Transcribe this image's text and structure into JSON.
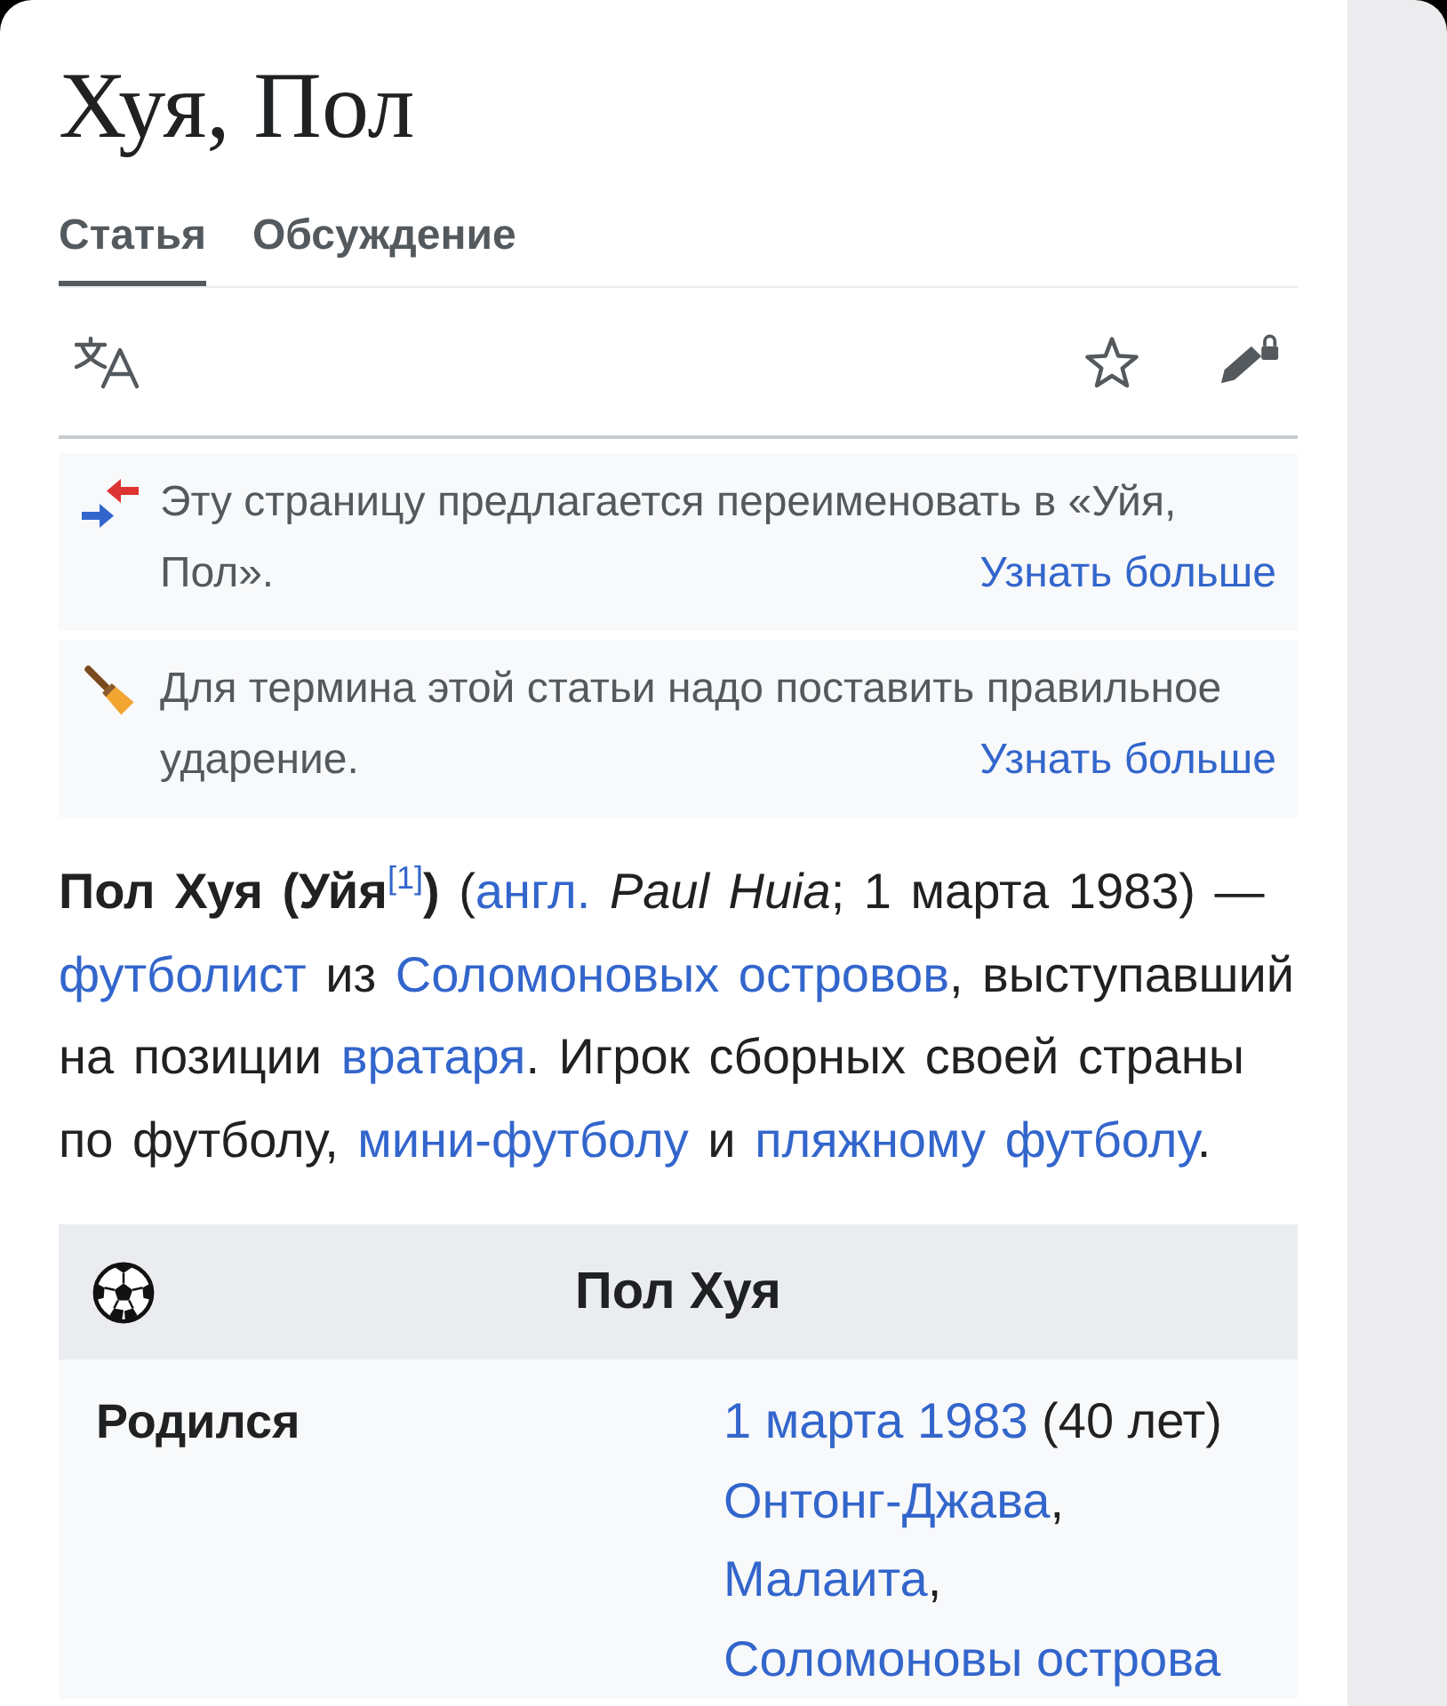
{
  "page": {
    "title": "Хуя, Пол"
  },
  "tabs": [
    {
      "label": "Статья",
      "selected": true
    },
    {
      "label": "Обсуждение",
      "selected": false
    }
  ],
  "notices": [
    {
      "kind": "rename",
      "text": "Эту страницу предлагается переименовать в «Уйя, Пол».",
      "link": "Узнать больше"
    },
    {
      "kind": "stress",
      "text": "Для термина этой статьи надо поставить правильное ударение.",
      "link": "Узнать больше"
    }
  ],
  "lead": [
    {
      "kind": "bold",
      "text": "Пол Хуя (Уйя"
    },
    {
      "kind": "ref",
      "text": "[1]"
    },
    {
      "kind": "bold",
      "text": ")"
    },
    {
      "kind": "text",
      "text": " ("
    },
    {
      "kind": "link",
      "text": "англ."
    },
    {
      "kind": "text",
      "text": " *Paul Huia*; 1 марта 1983) — "
    },
    {
      "kind": "link",
      "text": "футболист"
    },
    {
      "kind": "text",
      "text": " из "
    },
    {
      "kind": "link",
      "text": "Соломоновых островов"
    },
    {
      "kind": "text",
      "text": ", выступавший на позиции "
    },
    {
      "kind": "link",
      "text": "вратаря"
    },
    {
      "kind": "text",
      "text": ". Игрок сборных своей страны по футболу, "
    },
    {
      "kind": "link",
      "text": "мини-футболу"
    },
    {
      "kind": "text",
      "text": " и "
    },
    {
      "kind": "link",
      "text": "пляжному футболу"
    },
    {
      "kind": "text",
      "text": "."
    }
  ],
  "infobox": {
    "title": "Пол Хуя",
    "rows": [
      {
        "label": "Родился",
        "value": [
          {
            "kind": "link",
            "text": "1 марта 1983"
          },
          {
            "kind": "text",
            "text": " (40 лет) "
          },
          {
            "kind": "link",
            "text": "Онтонг-Джава"
          },
          {
            "kind": "text",
            "text": ", "
          },
          {
            "kind": "link",
            "text": "Малаита"
          },
          {
            "kind": "text",
            "text": ", "
          },
          {
            "kind": "link",
            "text": "Соломоновы острова"
          }
        ]
      }
    ]
  }
}
